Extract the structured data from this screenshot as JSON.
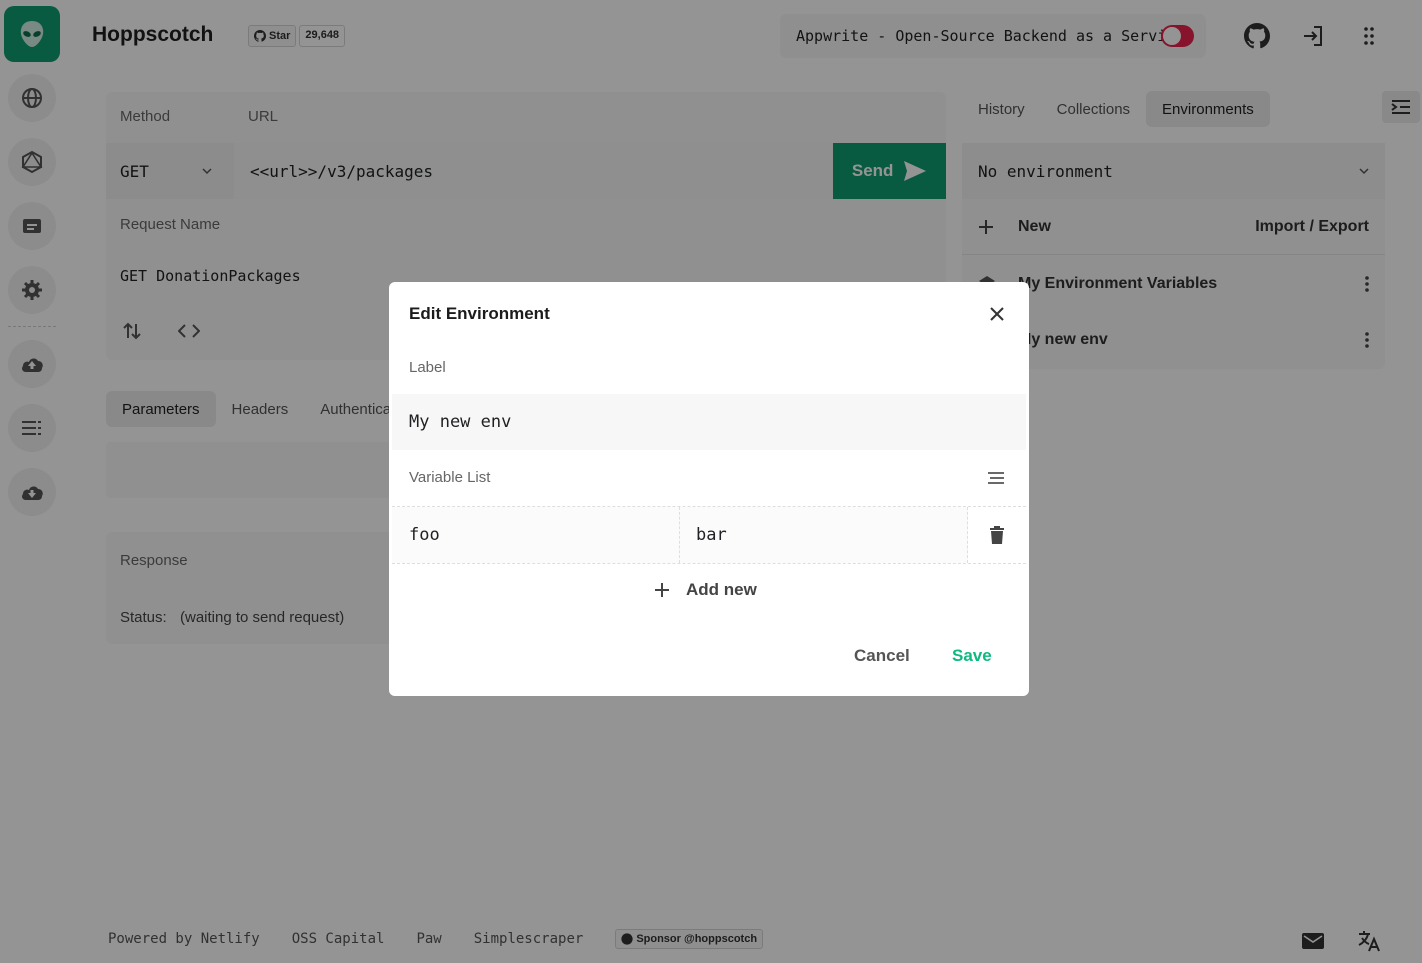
{
  "app": {
    "title": "Hoppscotch"
  },
  "github": {
    "star_label": "Star",
    "star_count": "29,648"
  },
  "ad": {
    "text": "Appwrite - Open-Source Backend as a Service"
  },
  "request": {
    "method_label": "Method",
    "url_label": "URL",
    "method": "GET",
    "url": "<<url>>/v3/packages",
    "send_label": "Send",
    "name_label": "Request Name",
    "name": "GET DonationPackages"
  },
  "req_tabs": [
    "Parameters",
    "Headers",
    "Authentication"
  ],
  "response": {
    "label": "Response",
    "status_label": "Status:",
    "status_value": "(waiting to send request)"
  },
  "right_panel": {
    "tabs": [
      "History",
      "Collections",
      "Environments"
    ],
    "env_select": "No environment",
    "new_label": "New",
    "import_export_label": "Import / Export",
    "envs": [
      "My Environment Variables",
      "My new env"
    ]
  },
  "footer": {
    "links": [
      "Powered by Netlify",
      "OSS Capital",
      "Paw",
      "Simplescraper"
    ],
    "sponsor": "Sponsor @hoppscotch"
  },
  "modal": {
    "title": "Edit Environment",
    "label_label": "Label",
    "label_value": "My new env",
    "var_list_label": "Variable List",
    "variables": [
      {
        "key": "foo",
        "value": "bar"
      }
    ],
    "add_new_label": "Add new",
    "cancel_label": "Cancel",
    "save_label": "Save"
  },
  "colors": {
    "accent": "#0f9d6e",
    "save": "#10b981",
    "toggle": "#e8244c"
  }
}
